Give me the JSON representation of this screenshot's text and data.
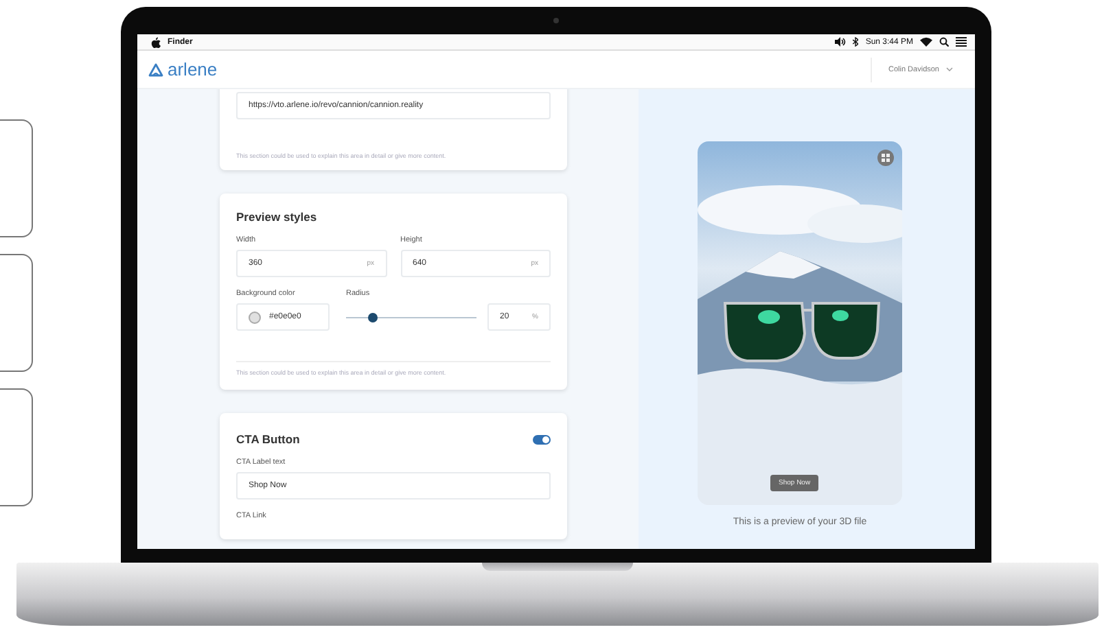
{
  "menu_bar": {
    "app": "Finder",
    "clock": "Sun 3:44 PM"
  },
  "header": {
    "logo": "arlene",
    "user": "Colin Davidson"
  },
  "url_section": {
    "url": "https://vto.arlene.io/revo/cannion/cannion.reality",
    "help": "This section could be used to explain this area in detail or give more content."
  },
  "preview_styles": {
    "title": "Preview styles",
    "width": {
      "label": "Width",
      "value": "360",
      "unit": "px"
    },
    "height": {
      "label": "Height",
      "value": "640",
      "unit": "px"
    },
    "background_color": {
      "label": "Background color",
      "value": "#e0e0e0"
    },
    "radius": {
      "label": "Radius",
      "level": 0.2,
      "value": "20",
      "unit": "%"
    },
    "help": "This section could be used to explain this area in detail or give more content."
  },
  "cta_button": {
    "title": "CTA Button",
    "on": true,
    "label_text": {
      "label": "CTA Label text",
      "value": "Shop Now"
    },
    "link_label": "CTA Link"
  },
  "preview": {
    "button": "Shop Now",
    "caption": "This is a preview of your 3D file"
  }
}
